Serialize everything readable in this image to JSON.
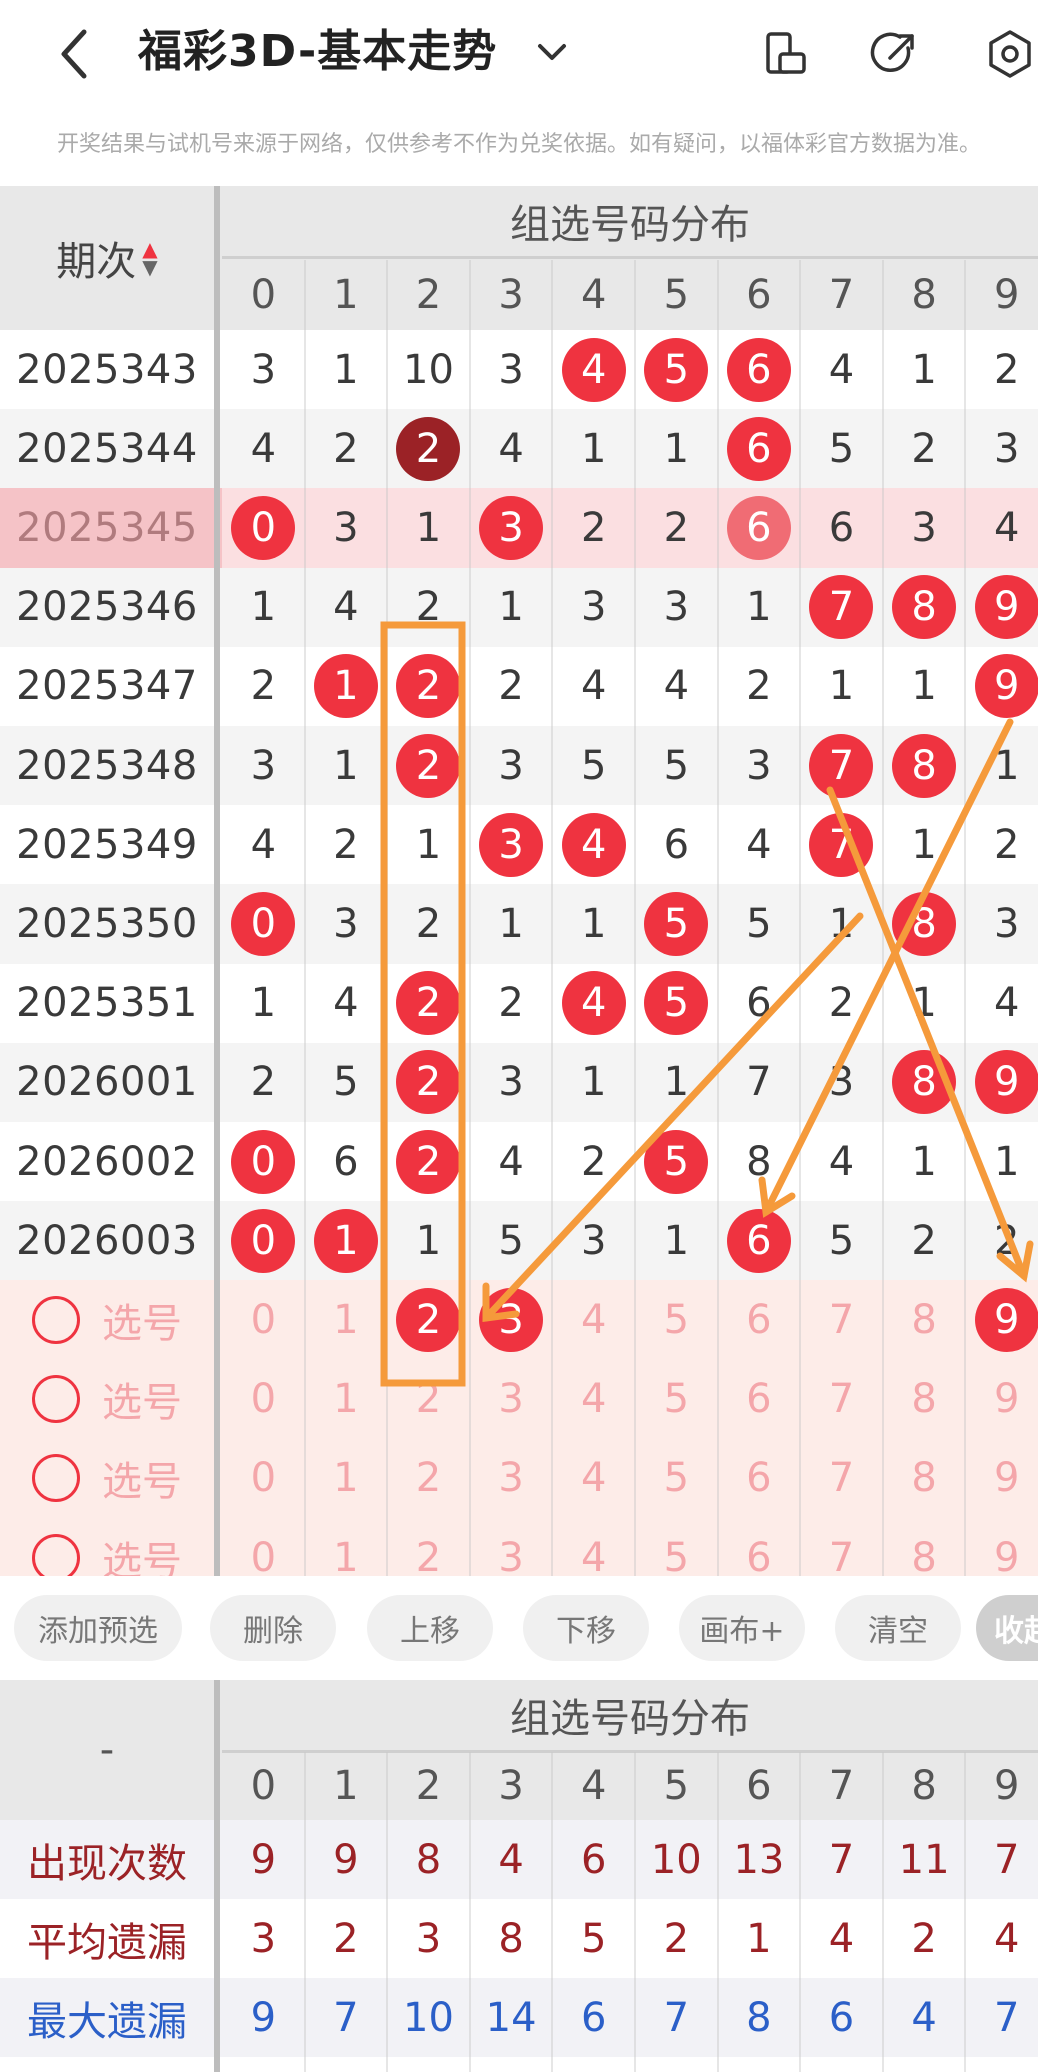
{
  "header": {
    "title": "福彩3D-基本走势",
    "back_icon": "chevron-left-icon",
    "dropdown_icon": "chevron-down-icon",
    "icons": [
      "phone-rotate-icon",
      "share-icon",
      "settings-gear-icon"
    ]
  },
  "disclaimer": "开奖结果与试机号来源于网络，仅供参考不作为兑奖依据。如有疑问，以福体彩官方数据为准。",
  "table": {
    "period_header": "期次",
    "section_title": "组选号码分布",
    "digits": [
      "0",
      "1",
      "2",
      "3",
      "4",
      "5",
      "6",
      "7",
      "8",
      "9"
    ],
    "rows": [
      {
        "period": "2025343",
        "cells": [
          "3",
          "1",
          "10",
          "3",
          "4",
          "5",
          "6",
          "4",
          "1",
          "2"
        ],
        "hits": [
          4,
          5,
          6
        ],
        "highlight": false
      },
      {
        "period": "2025344",
        "cells": [
          "4",
          "2",
          "2",
          "4",
          "1",
          "1",
          "6",
          "5",
          "2",
          "3"
        ],
        "hits": [
          2,
          6
        ],
        "dark": [
          2
        ],
        "highlight": false
      },
      {
        "period": "2025345",
        "cells": [
          "0",
          "3",
          "1",
          "3",
          "2",
          "2",
          "6",
          "6",
          "3",
          "4"
        ],
        "hits": [
          0,
          3,
          6
        ],
        "highlight": true
      },
      {
        "period": "2025346",
        "cells": [
          "1",
          "4",
          "2",
          "1",
          "3",
          "3",
          "1",
          "7",
          "8",
          "9"
        ],
        "hits": [
          7,
          8,
          9
        ],
        "highlight": false
      },
      {
        "period": "2025347",
        "cells": [
          "2",
          "1",
          "2",
          "2",
          "4",
          "4",
          "2",
          "1",
          "1",
          "9"
        ],
        "hits": [
          1,
          2,
          9
        ],
        "highlight": false
      },
      {
        "period": "2025348",
        "cells": [
          "3",
          "1",
          "2",
          "3",
          "5",
          "5",
          "3",
          "7",
          "8",
          "1"
        ],
        "hits": [
          2,
          7,
          8
        ],
        "highlight": false
      },
      {
        "period": "2025349",
        "cells": [
          "4",
          "2",
          "1",
          "3",
          "4",
          "6",
          "4",
          "7",
          "1",
          "2"
        ],
        "hits": [
          3,
          4,
          7
        ],
        "highlight": false
      },
      {
        "period": "2025350",
        "cells": [
          "0",
          "3",
          "2",
          "1",
          "1",
          "5",
          "5",
          "1",
          "8",
          "3"
        ],
        "hits": [
          0,
          5,
          8
        ],
        "highlight": false
      },
      {
        "period": "2025351",
        "cells": [
          "1",
          "4",
          "2",
          "2",
          "4",
          "5",
          "6",
          "2",
          "1",
          "4"
        ],
        "hits": [
          2,
          4,
          5
        ],
        "highlight": false
      },
      {
        "period": "2026001",
        "cells": [
          "2",
          "5",
          "2",
          "3",
          "1",
          "1",
          "7",
          "3",
          "8",
          "9"
        ],
        "hits": [
          2,
          8,
          9
        ],
        "highlight": false
      },
      {
        "period": "2026002",
        "cells": [
          "0",
          "6",
          "2",
          "4",
          "2",
          "5",
          "8",
          "4",
          "1",
          "1"
        ],
        "hits": [
          0,
          2,
          5
        ],
        "highlight": false
      },
      {
        "period": "2026003",
        "cells": [
          "0",
          "1",
          "1",
          "5",
          "3",
          "1",
          "6",
          "5",
          "2",
          "2"
        ],
        "hits": [
          0,
          1,
          6
        ],
        "highlight": false
      }
    ],
    "select_label": "选号",
    "select_rows": [
      {
        "selected": [
          2,
          3,
          9
        ]
      },
      {
        "selected": []
      },
      {
        "selected": []
      },
      {
        "selected": []
      }
    ]
  },
  "toolbar": [
    "添加预选",
    "删除",
    "上移",
    "下移",
    "画布+",
    "清空",
    "收起"
  ],
  "stats": {
    "corner": "-",
    "section_title": "组选号码分布",
    "digits": [
      "0",
      "1",
      "2",
      "3",
      "4",
      "5",
      "6",
      "7",
      "8",
      "9"
    ],
    "rows": [
      {
        "label": "出现次数",
        "values": [
          "9",
          "9",
          "8",
          "4",
          "6",
          "10",
          "13",
          "7",
          "11",
          "7"
        ],
        "color": "#9b2226"
      },
      {
        "label": "平均遗漏",
        "values": [
          "3",
          "2",
          "3",
          "8",
          "5",
          "2",
          "1",
          "4",
          "2",
          "4"
        ],
        "color": "#9b2226"
      },
      {
        "label": "最大遗漏",
        "values": [
          "9",
          "7",
          "10",
          "14",
          "6",
          "7",
          "8",
          "6",
          "4",
          "7"
        ],
        "color": "#2b5fc8"
      }
    ]
  },
  "colors": {
    "ball": "#ef3340",
    "ball_dark": "#9b2226",
    "highlight_row": "#fbdfe1",
    "select_bg": "#fdece8",
    "annotation": "#f59a3b"
  }
}
